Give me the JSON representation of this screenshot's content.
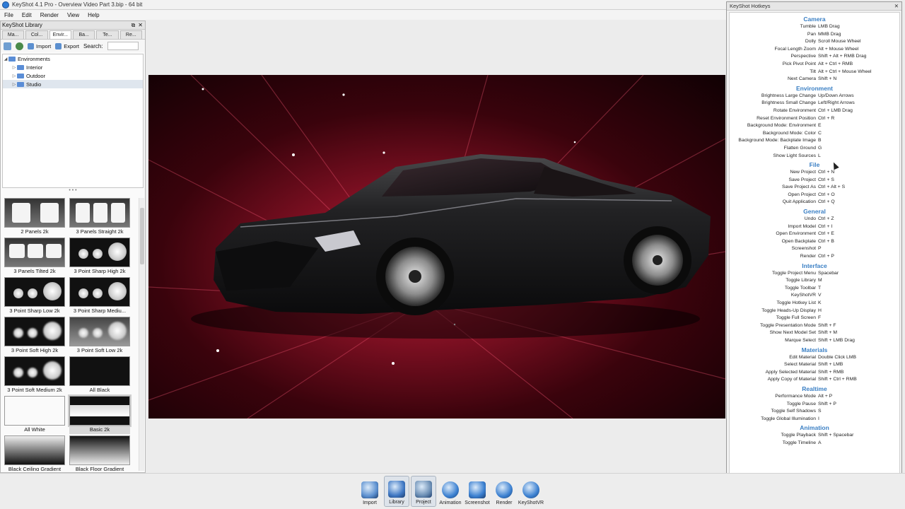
{
  "window": {
    "title": "KeyShot 4.1 Pro - Overview Video Part 3.bip - 64 bit"
  },
  "menu": [
    "File",
    "Edit",
    "Render",
    "View",
    "Help"
  ],
  "library": {
    "title": "KeyShot Library",
    "tabs": [
      "Ma...",
      "Col...",
      "Envir...",
      "Ba...",
      "Te...",
      "Re..."
    ],
    "active_tab": 2,
    "toolbar": {
      "import": "Import",
      "export": "Export",
      "search_label": "Search:"
    },
    "tree": {
      "root": "Environments",
      "children": [
        "Interior",
        "Outdoor",
        "Studio"
      ],
      "selected": "Studio"
    },
    "thumbnails": [
      "2 Panels 2k",
      "3 Panels Straight 2k",
      "3 Panels Tilted 2k",
      "3 Point Sharp High 2k",
      "3 Point Sharp Low 2k",
      "3 Point Sharp Mediu...",
      "3 Point Soft High 2k",
      "3 Point Soft Low 2k",
      "3 Point Soft Medium 2k",
      "All Black",
      "All White",
      "Basic 2k",
      "Black Ceiling Gradient",
      "Black Floor Gradient"
    ],
    "selected_thumbnail": "Basic 2k"
  },
  "dock": [
    {
      "label": "Import",
      "icon": "import-icon"
    },
    {
      "label": "Library",
      "icon": "library-icon"
    },
    {
      "label": "Project",
      "icon": "project-icon"
    },
    {
      "label": "Animation",
      "icon": "animation-icon"
    },
    {
      "label": "Screenshot",
      "icon": "screenshot-icon"
    },
    {
      "label": "Render",
      "icon": "render-icon"
    },
    {
      "label": "KeyShotVR",
      "icon": "keyshotvr-icon"
    }
  ],
  "hotkeys": {
    "title": "KeyShot Hotkeys",
    "sections": [
      {
        "name": "Camera",
        "rows": [
          [
            "Tumble",
            "LMB Drag"
          ],
          [
            "Pan",
            "MMB Drag"
          ],
          [
            "Dolly",
            "Scroll Mouse Wheel"
          ],
          [
            "Focal Length Zoom",
            "Alt + Mouse Wheel"
          ],
          [
            "Perspective",
            "Shift + Alt + RMB Drag"
          ],
          [
            "Pick Pivot Point",
            "Alt + Ctrl + RMB"
          ],
          [
            "Tilt",
            "Alt + Ctrl + Mouse Wheel"
          ],
          [
            "Next Camera",
            "Shift + N"
          ]
        ]
      },
      {
        "name": "Environment",
        "rows": [
          [
            "Brightness Large Change",
            "Up/Down Arrows"
          ],
          [
            "Brightness Small Change",
            "Left/Right Arrows"
          ],
          [
            "Rotate Environment",
            "Ctrl + LMB Drag"
          ],
          [
            "Reset Environment Position",
            "Ctrl + R"
          ],
          [
            "Background Mode: Environment",
            "E"
          ],
          [
            "Background Mode: Color",
            "C"
          ],
          [
            "Background Mode: Backplate Image",
            "B"
          ],
          [
            "Flatten Ground",
            "G"
          ],
          [
            "Show Light Sources",
            "L"
          ]
        ]
      },
      {
        "name": "File",
        "rows": [
          [
            "New Project",
            "Ctrl + N"
          ],
          [
            "Save Project",
            "Ctrl + S"
          ],
          [
            "Save Project As",
            "Ctrl + Alt + S"
          ],
          [
            "Open Project",
            "Ctrl + O"
          ],
          [
            "Quit Application",
            "Ctrl + Q"
          ]
        ]
      },
      {
        "name": "General",
        "rows": [
          [
            "Undo",
            "Ctrl + Z"
          ],
          [
            "Import Model",
            "Ctrl + I"
          ],
          [
            "Open Environment",
            "Ctrl + E"
          ],
          [
            "Open Backplate",
            "Ctrl + B"
          ],
          [
            "Screenshot",
            "P"
          ],
          [
            "Render",
            "Ctrl + P"
          ]
        ]
      },
      {
        "name": "Interface",
        "rows": [
          [
            "Toggle Project Menu",
            "Spacebar"
          ],
          [
            "Toggle Library",
            "M"
          ],
          [
            "Toggle Toolbar",
            "T"
          ],
          [
            "KeyShotVR",
            "V"
          ],
          [
            "Toggle Hotkey List",
            "K"
          ],
          [
            "Toggle Heads-Up Display",
            "H"
          ],
          [
            "Toggle Full Screen",
            "F"
          ],
          [
            "Toggle Presentation Mode",
            "Shift + F"
          ],
          [
            "Show Next Model Set",
            "Shift + M"
          ],
          [
            "Marque Select",
            "Shift + LMB Drag"
          ]
        ]
      },
      {
        "name": "Materials",
        "rows": [
          [
            "Edit Material",
            "Double Click LMB"
          ],
          [
            "Select Material",
            "Shift + LMB"
          ],
          [
            "Apply Selected Material",
            "Shift + RMB"
          ],
          [
            "Apply Copy of Material",
            "Shift + Ctrl + RMB"
          ]
        ]
      },
      {
        "name": "Realtime",
        "rows": [
          [
            "Performance Mode",
            "Alt + P"
          ],
          [
            "Toggle Pause",
            "Shift + P"
          ],
          [
            "Toggle Self Shadows",
            "S"
          ],
          [
            "Toggle Global Illumination",
            "I"
          ]
        ]
      },
      {
        "name": "Animation",
        "rows": [
          [
            "Toggle Playback",
            "Shift + Spacebar"
          ],
          [
            "Toggle Timeline",
            "A"
          ]
        ]
      }
    ]
  }
}
